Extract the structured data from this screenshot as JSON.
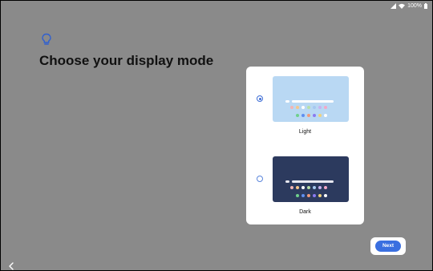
{
  "status_bar": {
    "battery": "100%"
  },
  "page": {
    "title": "Choose your display mode"
  },
  "options": [
    {
      "label": "Light",
      "selected": true
    },
    {
      "label": "Dark",
      "selected": false
    }
  ],
  "footer": {
    "next_label": "Next"
  },
  "colors": {
    "background": "#8a8a8a",
    "accent": "#3a6fe0",
    "light_preview": "#b9d8f3",
    "dark_preview": "#2c3a5e"
  },
  "icons": [
    "wifi-icon",
    "battery-icon",
    "lightbulb-icon",
    "back-chevron-icon"
  ]
}
